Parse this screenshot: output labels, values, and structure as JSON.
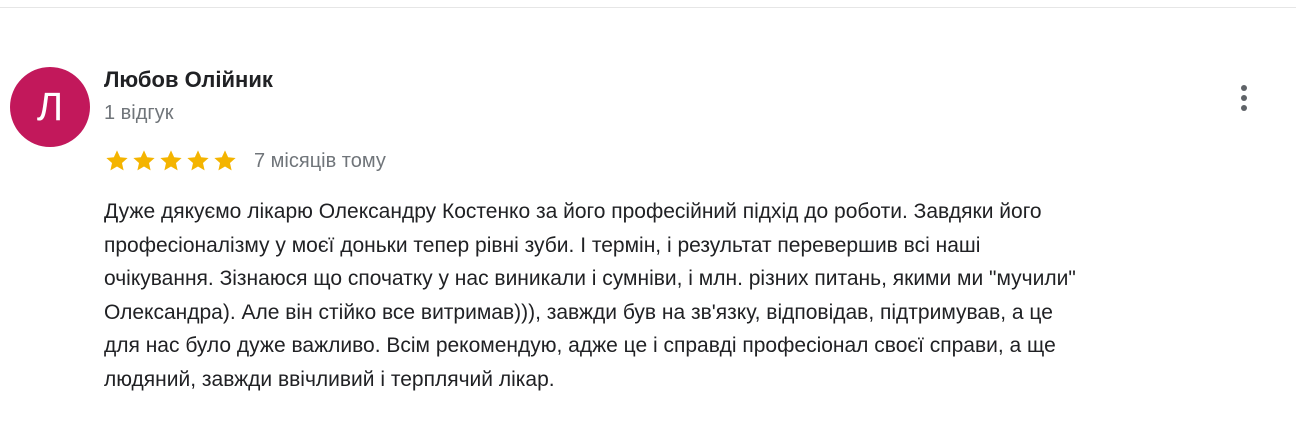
{
  "review": {
    "author": {
      "initial": "Л",
      "name": "Любов Олійник",
      "review_count": "1 відгук",
      "avatar_color": "#c2185b"
    },
    "rating": {
      "stars": 5,
      "max_stars": 5,
      "star_color": "#f4b400",
      "date": "7 місяців тому"
    },
    "menu_icon": "more-vert-icon",
    "text_lines": [
      "Дуже дякуємо лікарю Олександру Костенко за його професійний підхід до роботи. Завдяки його",
      "професіоналізму у моєї доньки тепер рівні зуби. І термін, і результат перевершив всі наші",
      "очікування. Зізнаюся що спочатку у нас виникали і сумніви, і млн. різних питань, якими ми \"мучили\"",
      "Олександра). Але він стійко все витримав))), завжди був на зв'язку, відповідав, підтримував, а це",
      "для нас було дуже важливо. Всім рекомендую, адже це і справді професіонал своєї справи, а ще",
      "людяний, завжди ввічливий і терплячий лікар."
    ]
  }
}
